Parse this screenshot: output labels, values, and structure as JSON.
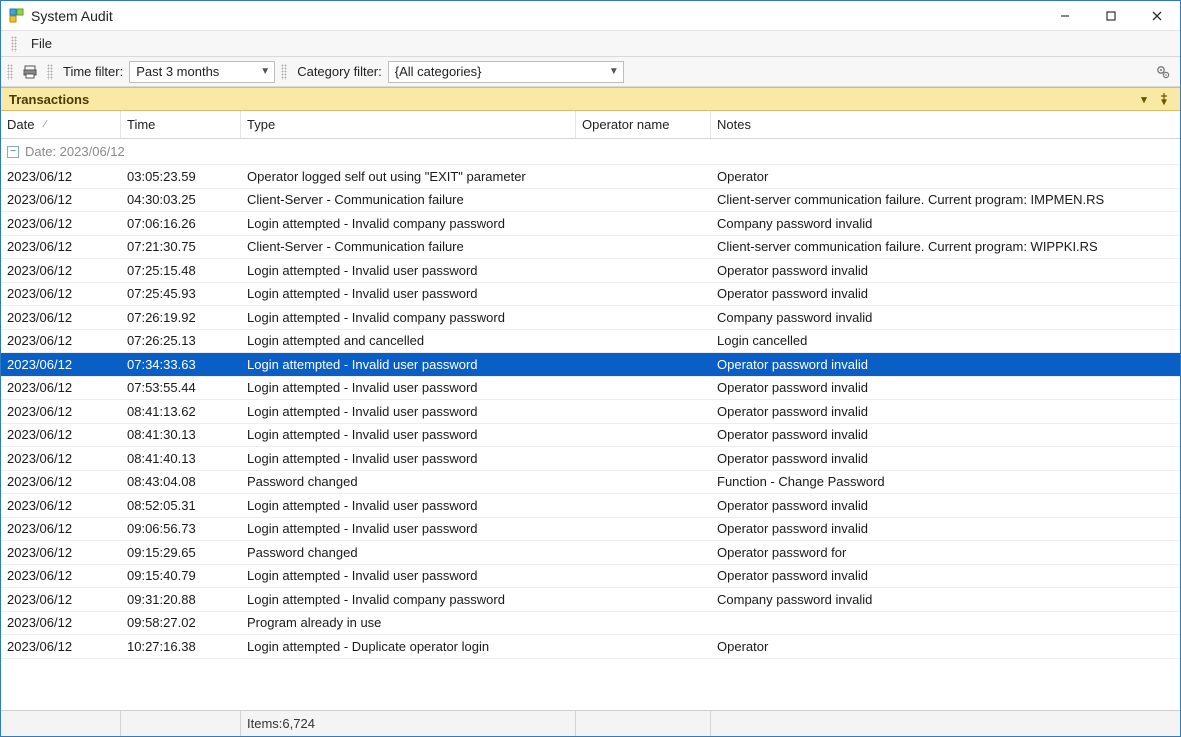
{
  "window": {
    "title": "System Audit"
  },
  "menu": {
    "file": "File"
  },
  "toolbar": {
    "time_filter_label": "Time filter:",
    "time_filter_value": "Past 3 months",
    "category_filter_label": "Category filter:",
    "category_filter_value": "{All categories}"
  },
  "panel": {
    "title": "Transactions"
  },
  "columns": {
    "date": "Date",
    "time": "Time",
    "type": "Type",
    "operator": "Operator name",
    "notes": "Notes"
  },
  "group": {
    "label": "Date: 2023/06/12"
  },
  "rows": [
    {
      "date": "2023/06/12",
      "time": "03:05:23.59",
      "type": "Operator logged self out using \"EXIT\" parameter",
      "op": "",
      "notes": "Operator",
      "selected": false
    },
    {
      "date": "2023/06/12",
      "time": "04:30:03.25",
      "type": "Client-Server - Communication failure",
      "op": "",
      "notes": "Client-server communication failure. Current program: IMPMEN.RS",
      "selected": false
    },
    {
      "date": "2023/06/12",
      "time": "07:06:16.26",
      "type": "Login attempted - Invalid company password",
      "op": "",
      "notes": "Company       password invalid",
      "selected": false
    },
    {
      "date": "2023/06/12",
      "time": "07:21:30.75",
      "type": "Client-Server - Communication failure",
      "op": "",
      "notes": "Client-server communication failure. Current program: WIPPKI.RS",
      "selected": false
    },
    {
      "date": "2023/06/12",
      "time": "07:25:15.48",
      "type": "Login attempted - Invalid user password",
      "op": "",
      "notes": "Operator          password invalid",
      "selected": false
    },
    {
      "date": "2023/06/12",
      "time": "07:25:45.93",
      "type": "Login attempted - Invalid user password",
      "op": "",
      "notes": "Operator          password invalid",
      "selected": false
    },
    {
      "date": "2023/06/12",
      "time": "07:26:19.92",
      "type": "Login attempted - Invalid company password",
      "op": "",
      "notes": "Company       password invalid",
      "selected": false
    },
    {
      "date": "2023/06/12",
      "time": "07:26:25.13",
      "type": "Login attempted and cancelled",
      "op": "",
      "notes": "Login cancelled",
      "selected": false
    },
    {
      "date": "2023/06/12",
      "time": "07:34:33.63",
      "type": "Login attempted - Invalid user password",
      "op": "",
      "notes": "Operator          password invalid",
      "selected": true
    },
    {
      "date": "2023/06/12",
      "time": "07:53:55.44",
      "type": "Login attempted - Invalid user password",
      "op": "",
      "notes": "Operator          password invalid",
      "selected": false
    },
    {
      "date": "2023/06/12",
      "time": "08:41:13.62",
      "type": "Login attempted - Invalid user password",
      "op": "",
      "notes": "Operator        password invalid",
      "selected": false
    },
    {
      "date": "2023/06/12",
      "time": "08:41:30.13",
      "type": "Login attempted - Invalid user password",
      "op": "",
      "notes": "Operator        password invalid",
      "selected": false
    },
    {
      "date": "2023/06/12",
      "time": "08:41:40.13",
      "type": "Login attempted - Invalid user password",
      "op": "",
      "notes": "Operator        password invalid",
      "selected": false
    },
    {
      "date": "2023/06/12",
      "time": "08:43:04.08",
      "type": "Password changed",
      "op": "",
      "notes": "Function - Change Password",
      "selected": false
    },
    {
      "date": "2023/06/12",
      "time": "08:52:05.31",
      "type": "Login attempted - Invalid user password",
      "op": "",
      "notes": "Operator          password invalid",
      "selected": false
    },
    {
      "date": "2023/06/12",
      "time": "09:06:56.73",
      "type": "Login attempted - Invalid user password",
      "op": "",
      "notes": "Operator          password invalid",
      "selected": false
    },
    {
      "date": "2023/06/12",
      "time": "09:15:29.65",
      "type": "Password changed",
      "op": "",
      "notes": "Operator password for",
      "selected": false
    },
    {
      "date": "2023/06/12",
      "time": "09:15:40.79",
      "type": "Login attempted - Invalid user password",
      "op": "",
      "notes": "Operator          password invalid",
      "selected": false
    },
    {
      "date": "2023/06/12",
      "time": "09:31:20.88",
      "type": "Login attempted - Invalid company password",
      "op": "",
      "notes": "Company       password invalid",
      "selected": false
    },
    {
      "date": "2023/06/12",
      "time": "09:58:27.02",
      "type": "Program already in use",
      "op": "",
      "notes": "",
      "selected": false
    },
    {
      "date": "2023/06/12",
      "time": "10:27:16.38",
      "type": "Login attempted - Duplicate operator login",
      "op": "",
      "notes": "Operator",
      "selected": false
    }
  ],
  "footer": {
    "items_label": "Items:6,724"
  }
}
